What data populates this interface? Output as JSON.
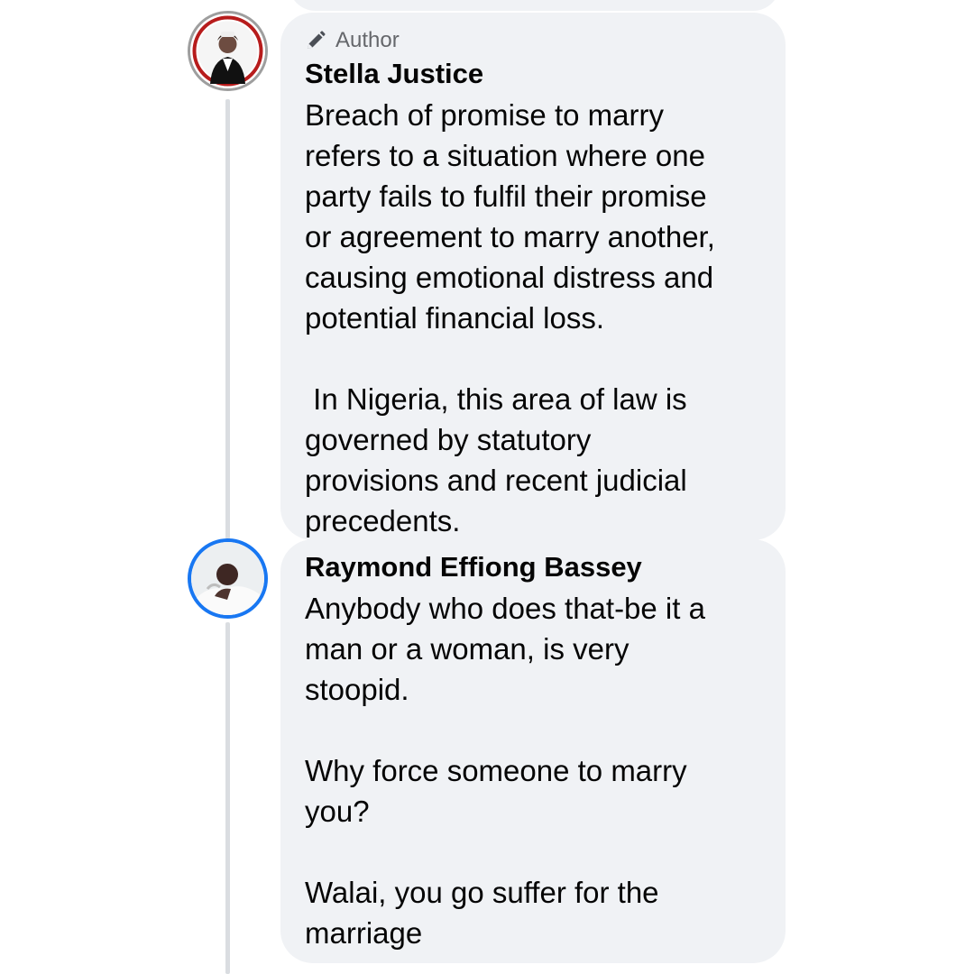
{
  "comments": [
    {
      "author_badge": "Author",
      "name": "Stella Justice",
      "lines": [
        "Breach of promise to marry",
        "refers to a situation where one",
        "party fails to fulfil their promise",
        "or agreement to marry another,",
        "causing emotional distress and",
        "potential financial loss.",
        "",
        " In Nigeria, this area of law is",
        "governed by statutory",
        "provisions and recent judicial",
        "precedents."
      ],
      "avatar_ring_color": "#b71c1c"
    },
    {
      "name": "Raymond Effiong Bassey",
      "lines": [
        "Anybody who does that-be it a",
        "man or a woman, is very",
        "stoopid.",
        "",
        "Why force someone to marry",
        "you?",
        "",
        "Walai, you go suffer for the",
        "marriage"
      ],
      "avatar_ring_color": "#1877f2"
    }
  ],
  "icons": {
    "author_badge_icon": "pencil-icon"
  },
  "colors": {
    "bubble_bg": "#f0f2f5",
    "secondary_text": "#65676b",
    "primary_text": "#050505",
    "thread_line": "#dadde1"
  }
}
